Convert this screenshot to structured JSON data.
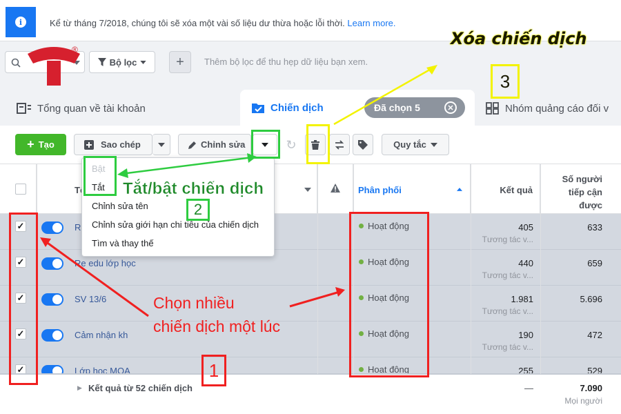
{
  "banner": {
    "text": "Kể từ tháng 7/2018, chúng tôi sẽ xóa một vài số liệu dư thừa hoặc lỗi thời.",
    "link": "Learn more."
  },
  "filter": {
    "filter_label": "Bộ lọc",
    "add_label": "+",
    "hint": "Thêm bộ lọc để thu hẹp dữ liệu bạn xem."
  },
  "logo": {
    "mark": "®"
  },
  "tabs": {
    "overview": "Tổng quan về tài khoản",
    "campaign": "Chiến dịch",
    "selected": "Đã chọn 5",
    "adsets": "Nhóm quảng cáo đối v"
  },
  "toolbar": {
    "create": "Tạo",
    "copy": "Sao chép",
    "edit": "Chỉnh sửa",
    "rules": "Quy tắc"
  },
  "table": {
    "headers": {
      "name_partial": "Tê",
      "delivery": "Phân phối",
      "results": "Kết quả",
      "reach": "Số người tiếp cận được"
    },
    "rows": [
      {
        "name": "Re",
        "status": "Hoạt động",
        "result": "405",
        "result_sub": "Tương tác v...",
        "reach": "633"
      },
      {
        "name": "Re edu lớp học",
        "status": "Hoạt động",
        "result": "440",
        "result_sub": "Tương tác v...",
        "reach": "659"
      },
      {
        "name": "SV 13/6",
        "status": "Hoạt động",
        "result": "1.981",
        "result_sub": "Tương tác v...",
        "reach": "5.696"
      },
      {
        "name": "Cảm nhận kh",
        "status": "Hoạt động",
        "result": "190",
        "result_sub": "Tương tác v...",
        "reach": "472"
      },
      {
        "name": "Lớp học MOA",
        "status": "Hoạt động",
        "result": "255",
        "result_sub": "",
        "reach": "529"
      }
    ],
    "footer": {
      "label": "Kết quả từ 52 chiến dịch",
      "result": "—",
      "reach": "7.090",
      "reach_sub": "Mọi người"
    }
  },
  "menu": {
    "items": [
      "Bật",
      "Tắt",
      "Chỉnh sửa tên",
      "Chỉnh sửa giới hạn chi tiêu của chiến dịch",
      "Tìm và thay thế"
    ]
  },
  "annotations": {
    "delete_title": "Xóa chiến dịch",
    "delete_num": "3",
    "toggle_title": "Tắt/bật chiến dịch",
    "toggle_num": "2",
    "multi_line1": "Chọn nhiều",
    "multi_line2": "chiến dịch một lúc",
    "multi_num": "1"
  },
  "colors": {
    "accent": "#1877f2",
    "create": "#42b72a",
    "annotation_red": "#f02020",
    "annotation_yellow": "#f3f300",
    "annotation_green": "#2ecc40"
  }
}
